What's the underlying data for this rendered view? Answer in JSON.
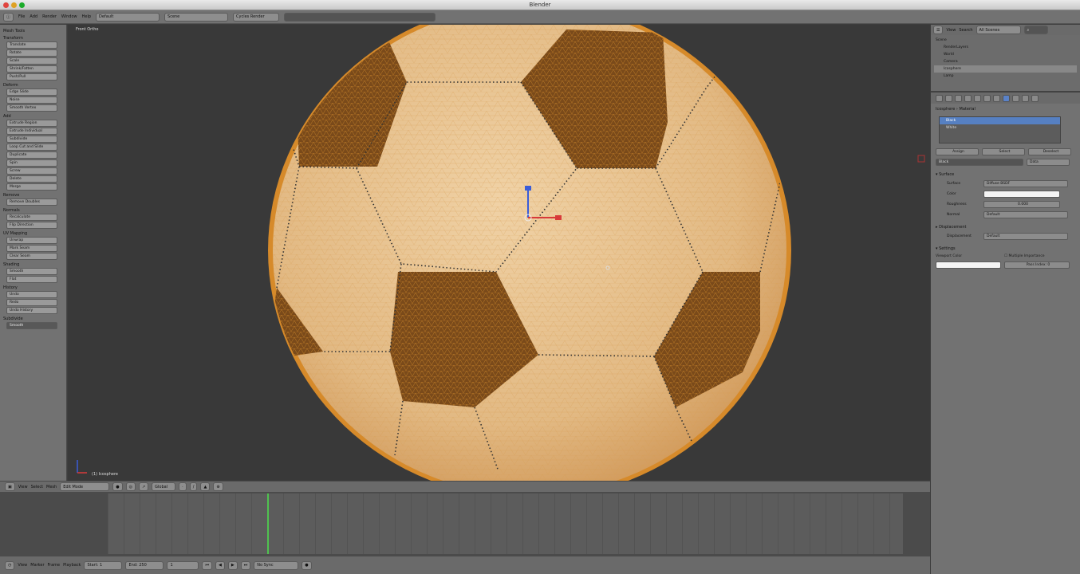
{
  "window": {
    "title": "Blender"
  },
  "colors": {
    "ball_white": "#e6be8a",
    "ball_patch": "#7a4a1a",
    "selection_edge": "#f0a030",
    "active_blue": "#5680c2",
    "frame_marker": "#4fc24f"
  },
  "info_header": {
    "menus": [
      "File",
      "Add",
      "Render",
      "Window",
      "Help"
    ],
    "layout": "Default",
    "scene": "Scene",
    "engine": "Cycles Render"
  },
  "toolshelf": {
    "title": "Mesh Tools",
    "sections": [
      {
        "title": "Transform",
        "buttons": [
          "Translate",
          "Rotate",
          "Scale",
          "Shrink/Fatten",
          "Push/Pull"
        ]
      },
      {
        "title": "Deform",
        "buttons": [
          "Edge Slide",
          "Noise",
          "Smooth Vertex"
        ]
      },
      {
        "title": "Add",
        "buttons": [
          "Extrude Region",
          "Extrude Individual",
          "Subdivide",
          "Loop Cut and Slide",
          "Duplicate",
          "Spin",
          "Screw",
          "Delete",
          "Merge"
        ]
      },
      {
        "title": "Remove",
        "buttons": [
          "Remove Doubles"
        ]
      },
      {
        "title": "Normals",
        "buttons": [
          "Recalculate",
          "Flip Direction"
        ]
      },
      {
        "title": "UV Mapping",
        "buttons": [
          "Unwrap",
          "Mark Seam",
          "Clear Seam"
        ]
      },
      {
        "title": "Shading",
        "buttons": [
          "Smooth",
          "Flat"
        ]
      },
      {
        "title": "History",
        "buttons": [
          "Undo",
          "Redo",
          "Undo History"
        ]
      }
    ],
    "footer_title": "Subdivide",
    "footer_value": "Smooth"
  },
  "viewport": {
    "view_label": "Front Ortho",
    "object_label": "(1) Icosphere",
    "footer_items": [
      "View",
      "Select",
      "Mesh",
      "Edit Mode",
      "Global"
    ]
  },
  "timeline": {
    "footer_items": [
      "View",
      "Marker",
      "Frame",
      "Playback"
    ],
    "start": "Start: 1",
    "end": "End: 250",
    "frame": "1",
    "sync": "No Sync"
  },
  "outliner": {
    "view": "View",
    "search": "Search",
    "filter": "All Scenes",
    "rows": [
      "Scene",
      "RenderLayers",
      "World",
      "Camera",
      "Icosphere",
      "Lamp"
    ]
  },
  "properties": {
    "breadcrumb": [
      "Icosphere",
      "Material"
    ],
    "materials": [
      "Black",
      "White"
    ],
    "buttons": [
      "Assign",
      "Select",
      "Deselect"
    ],
    "material_name": "Black",
    "data_label": "Data",
    "surface_title": "Surface",
    "surface_label": "Surface",
    "surface_value": "Diffuse BSDF",
    "color_label": "Color",
    "roughness_label": "Roughness",
    "roughness_value": "0.000",
    "normal_label": "Normal",
    "normal_value": "Default",
    "displacement_title": "Displacement",
    "displacement_label": "Displacement",
    "displacement_value": "Default",
    "settings_title": "Settings",
    "viewport_color_label": "Viewport Color",
    "multiple_importance": "Multiple Importance",
    "pass_index": "Pass Index: 0"
  }
}
